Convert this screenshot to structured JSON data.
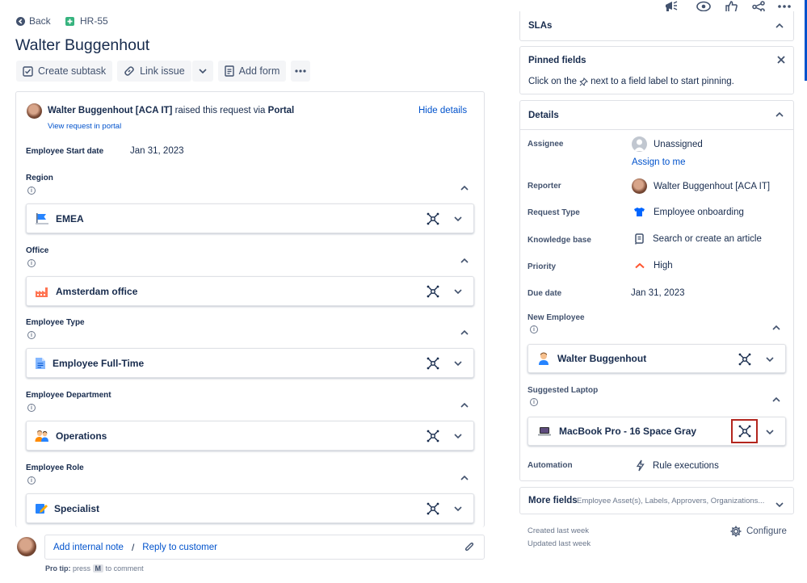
{
  "header": {
    "back_label": "Back",
    "issue_key": "HR-55",
    "issue_title": "Walter Buggenhout"
  },
  "toolbar": {
    "create_subtask": "Create subtask",
    "link_issue": "Link issue",
    "add_form": "Add form"
  },
  "request": {
    "reporter": "Walter Buggenhout [ACA IT]",
    "raised_text": "raised this request via",
    "channel": "Portal",
    "view_link": "View request in portal",
    "hide_details": "Hide details",
    "start_date_label": "Employee Start date",
    "start_date_value": "Jan 31, 2023"
  },
  "fields": [
    {
      "label": "Region",
      "value": "EMEA",
      "icon": "flag-icon"
    },
    {
      "label": "Office",
      "value": "Amsterdam office",
      "icon": "factory-icon"
    },
    {
      "label": "Employee Type",
      "value": "Employee Full-Time",
      "icon": "document-icon"
    },
    {
      "label": "Employee Department",
      "value": "Operations",
      "icon": "people-icon"
    },
    {
      "label": "Employee Role",
      "value": "Specialist",
      "icon": "pencil-icon"
    }
  ],
  "comment": {
    "add_internal_note": "Add internal note",
    "separator": "/",
    "reply_to_customer": "Reply to customer",
    "protip_prefix": "Pro tip:",
    "protip_press": "press",
    "protip_key": "M",
    "protip_suffix": "to comment"
  },
  "sidebar": {
    "slas_title": "SLAs",
    "pinned_title": "Pinned fields",
    "pinned_text_a": "Click on the",
    "pinned_text_b": "next to a field label to start pinning.",
    "details_title": "Details",
    "assignee_label": "Assignee",
    "assignee_value": "Unassigned",
    "assign_to_me": "Assign to me",
    "reporter_label": "Reporter",
    "reporter_value": "Walter Buggenhout [ACA IT]",
    "request_type_label": "Request Type",
    "request_type_value": "Employee onboarding",
    "kb_label": "Knowledge base",
    "kb_value": "Search or create an article",
    "priority_label": "Priority",
    "priority_value": "High",
    "due_label": "Due date",
    "due_value": "Jan 31, 2023",
    "new_employee_label": "New Employee",
    "new_employee_value": "Walter Buggenhout",
    "laptop_label": "Suggested Laptop",
    "laptop_value": "MacBook Pro - 16 Space Gray",
    "automation_label": "Automation",
    "automation_value": "Rule executions",
    "more_fields_title": "More fields",
    "more_fields_sub": "Employee Asset(s), Labels, Approvers, Organizations...",
    "created": "Created last week",
    "updated": "Updated last week",
    "configure": "Configure"
  },
  "colors": {
    "link": "#0052cc",
    "text": "#172b4d",
    "highlight_box": "#b3261e",
    "priority_high": "#ff5630"
  }
}
